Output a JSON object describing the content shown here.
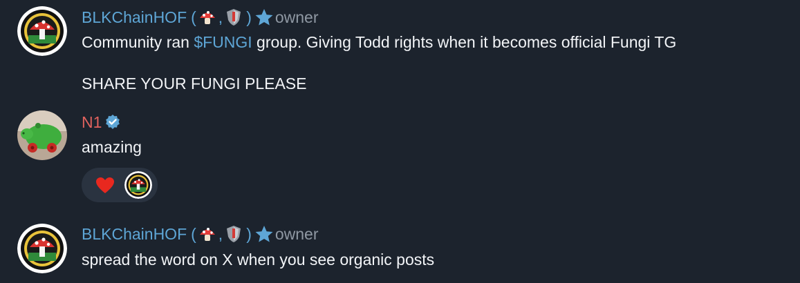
{
  "messages": [
    {
      "author": "BLKChainHOF",
      "paren_open": "(",
      "separator": ",",
      "paren_close": ")",
      "role": "owner",
      "avatar_icon": "mushroom-badge-avatar",
      "text_before_link": "Community ran ",
      "link_text": "$FUNGI",
      "text_after_link": " group. Giving Todd rights when it becomes official Fungi TG",
      "text_line2": "SHARE YOUR FUNGI PLEASE"
    },
    {
      "author": "N1",
      "avatar_icon": "green-toy-pig-avatar",
      "text": "amazing",
      "reactions": {
        "emoji": "heart",
        "reactor_avatar": "mushroom-badge-avatar"
      }
    },
    {
      "author": "BLKChainHOF",
      "paren_open": "(",
      "separator": ",",
      "paren_close": ")",
      "role": "owner",
      "avatar_icon": "mushroom-badge-avatar",
      "text": "spread the word on X when you see organic posts"
    }
  ],
  "colors": {
    "background": "#1c232d",
    "author_blue": "#5ea6d6",
    "author_red": "#e0625e",
    "role_gray": "#8f98a3",
    "text": "#f2f4f7",
    "reaction_pill": "#2a3340"
  }
}
